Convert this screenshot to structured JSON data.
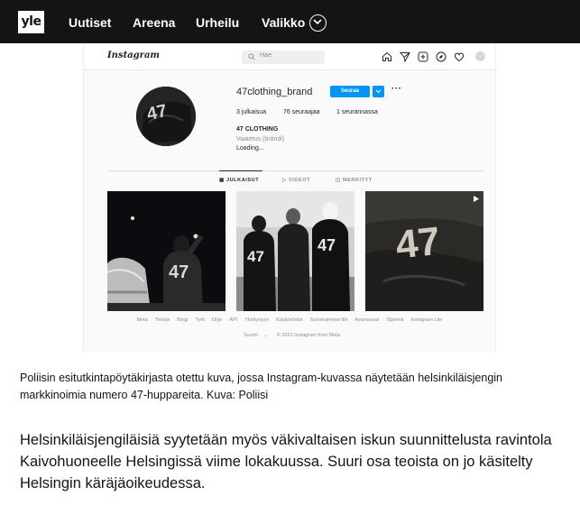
{
  "topbar": {
    "logo": "yle",
    "nav": [
      {
        "label": "Uutiset"
      },
      {
        "label": "Areena"
      },
      {
        "label": "Urheilu"
      },
      {
        "label": "Valikko",
        "icon": "chevron-down-circle-icon"
      }
    ]
  },
  "instagram": {
    "logo": "Instagram",
    "search_placeholder": "Hae",
    "header_icons": [
      "home-icon",
      "direct-message-icon",
      "new-post-icon",
      "explore-icon",
      "activity-heart-icon",
      "profile-avatar-icon"
    ],
    "profile": {
      "username": "47clothing_brand",
      "follow_label": "Seuraa",
      "more": "···",
      "stats": [
        "3 julkaisua",
        "76 seuraajaa",
        "1 seurannassa"
      ],
      "bio_name": "47 CLOTHING",
      "bio_category": "Vaatetus (brändi)",
      "bio_text": "Loading..."
    },
    "tabs": [
      {
        "label": "JULKAISUT",
        "active": true
      },
      {
        "label": "VIDEOT",
        "active": false
      },
      {
        "label": "MERKITYT",
        "active": false
      }
    ],
    "posts": [
      {
        "image": "hoodie-47-night-street"
      },
      {
        "image": "three-people-hoodies-47-bw"
      },
      {
        "image": "hoodie-47-closeup"
      }
    ],
    "footer_links": [
      "Meta",
      "Tietoja",
      "Blogi",
      "Työt",
      "Ohje",
      "API",
      "Yksityisyys",
      "Käyttöehdot",
      "Suosituimmat tilit",
      "Avainsanat",
      "Sijainnit",
      "Instagram Lite"
    ],
    "footer_language": "Suomi",
    "footer_copyright": "© 2022 Instagram from Meta"
  },
  "article": {
    "caption": "Poliisin esitutkintapöytäkirjasta otettu kuva, jossa Instagram-kuvassa näytetään helsinkiläisjengin markkinoimia numero 47-huppareita. Kuva: Poliisi",
    "lead": "Helsinkiläisjengiläisiä syytetään myös väkivaltaisen iskun suunnittelusta ravintola Kaivohuoneelle Helsingissä viime lokakuussa. Suuri osa teoista on jo käsitelty Helsingin käräjäoikeudessa."
  }
}
